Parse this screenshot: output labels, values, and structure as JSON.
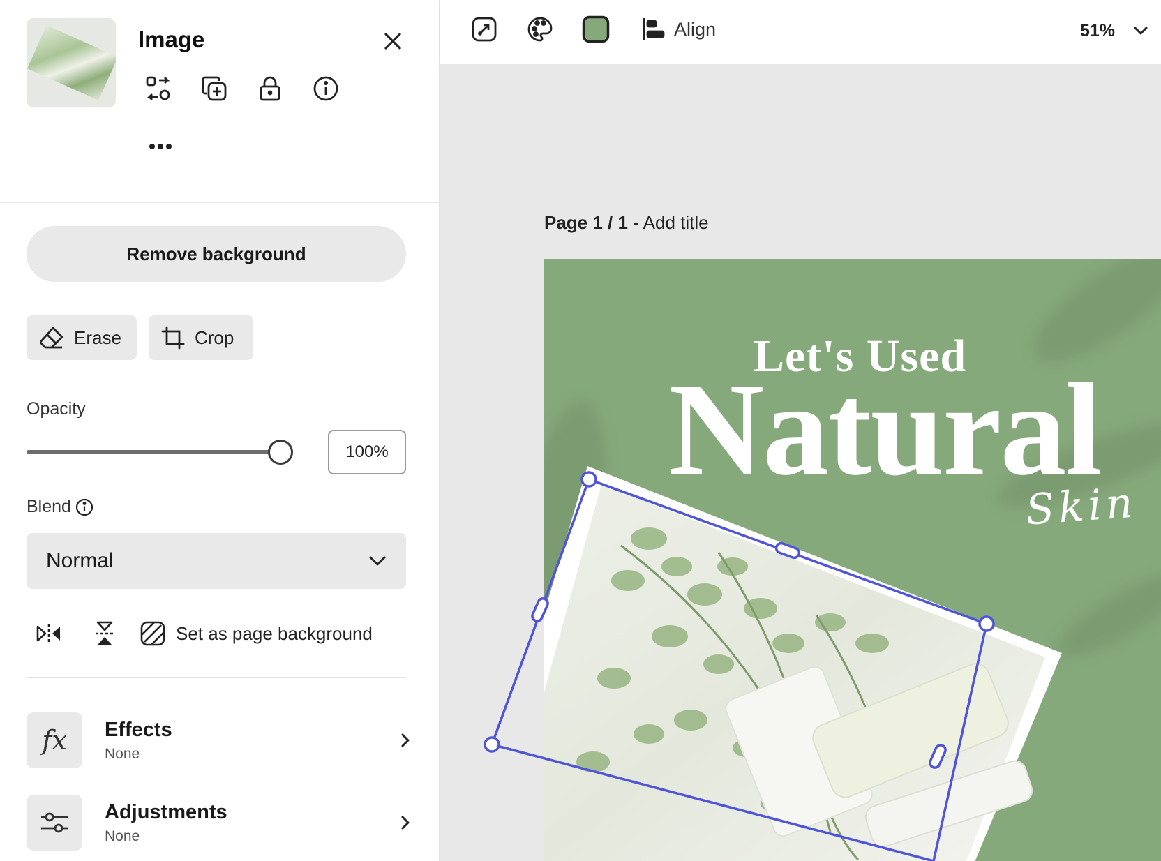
{
  "panel": {
    "title": "Image",
    "more_label": "•••",
    "remove_background": "Remove background",
    "erase": "Erase",
    "crop": "Crop",
    "opacity_label": "Opacity",
    "opacity_value": "100%",
    "opacity_fraction": 1.0,
    "blend_label": "Blend",
    "blend_value": "Normal",
    "set_as_background": "Set as page background",
    "effects": {
      "title": "Effects",
      "value": "None"
    },
    "adjustments": {
      "title": "Adjustments",
      "value": "None"
    }
  },
  "toolbar": {
    "icons": [
      "resize-icon",
      "color-palette-icon",
      "fill-color-swatch",
      "align-icon"
    ],
    "fill_color": "#86a97b",
    "align_label": "Align",
    "zoom": "51%"
  },
  "canvas": {
    "page_number": "Page 1 / 1 -",
    "page_title_placeholder": "Add title",
    "headline_small": "Let's Used",
    "headline_big": "Natural",
    "headline_script": "Skin",
    "background_color": "#86a97b",
    "selection_color": "#4f55d6"
  }
}
